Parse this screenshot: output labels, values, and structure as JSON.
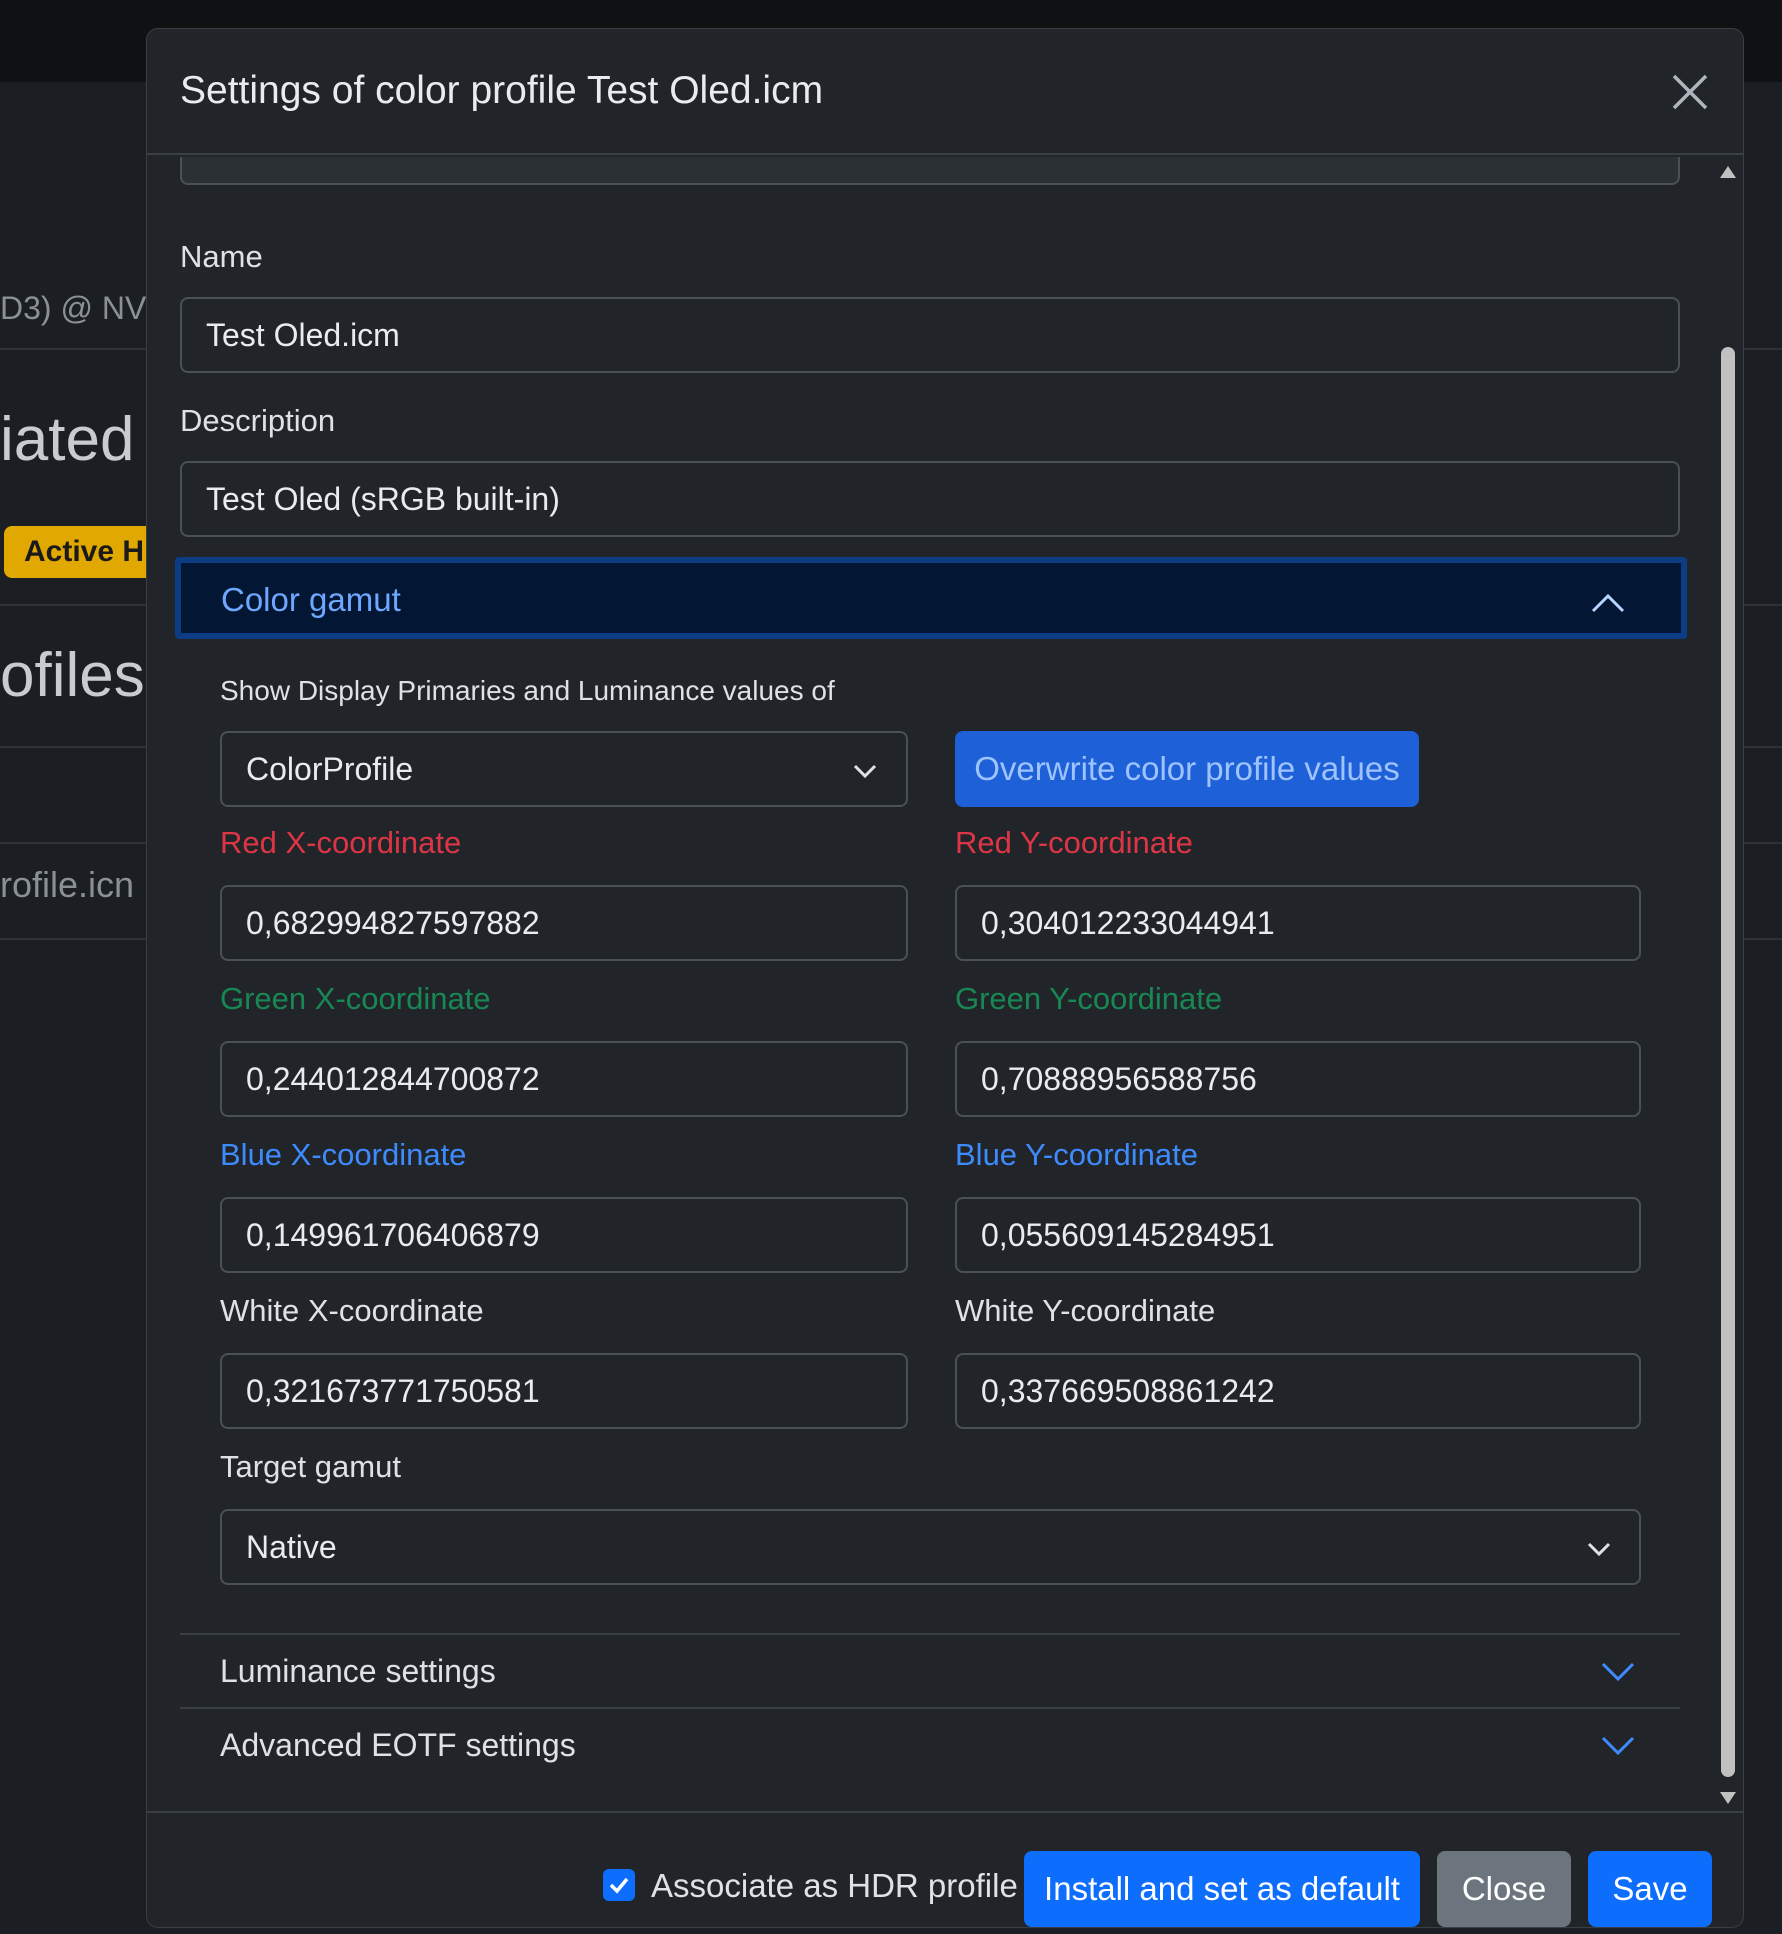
{
  "background": {
    "row1": "D3) @ NV",
    "heading1": "iated",
    "badge": "Active HI",
    "heading2": "ofiles",
    "row2": "rofile.icn"
  },
  "modal": {
    "title": "Settings of color profile Test Oled.icm",
    "close_icon": "close-icon",
    "name_label": "Name",
    "name_value": "Test Oled.icm",
    "description_label": "Description",
    "description_value": "Test Oled (sRGB built-in)",
    "color_gamut": {
      "title": "Color gamut",
      "show_label": "Show Display Primaries and Luminance values of",
      "source_select": "ColorProfile",
      "overwrite_button": "Overwrite color profile values",
      "red_x_label": "Red X-coordinate",
      "red_x": "0,682994827597882",
      "red_y_label": "Red Y-coordinate",
      "red_y": "0,304012233044941",
      "green_x_label": "Green X-coordinate",
      "green_x": "0,244012844700872",
      "green_y_label": "Green Y-coordinate",
      "green_y": "0,70888956588756",
      "blue_x_label": "Blue X-coordinate",
      "blue_x": "0,149961706406879",
      "blue_y_label": "Blue Y-coordinate",
      "blue_y": "0,055609145284951",
      "white_x_label": "White X-coordinate",
      "white_x": "0,321673771750581",
      "white_y_label": "White Y-coordinate",
      "white_y": "0,337669508861242",
      "target_gamut_label": "Target gamut",
      "target_gamut": "Native"
    },
    "luminance_settings": "Luminance settings",
    "advanced_eotf": "Advanced EOTF settings",
    "footer": {
      "associate_hdr_label": "Associate as HDR profile",
      "associate_hdr_checked": true,
      "install_button": "Install and set as default",
      "close_button": "Close",
      "save_button": "Save"
    }
  },
  "colors": {
    "red": "#dc3545",
    "green": "#198754",
    "blue": "#3d8bfd",
    "primary": "#0d6efd"
  }
}
